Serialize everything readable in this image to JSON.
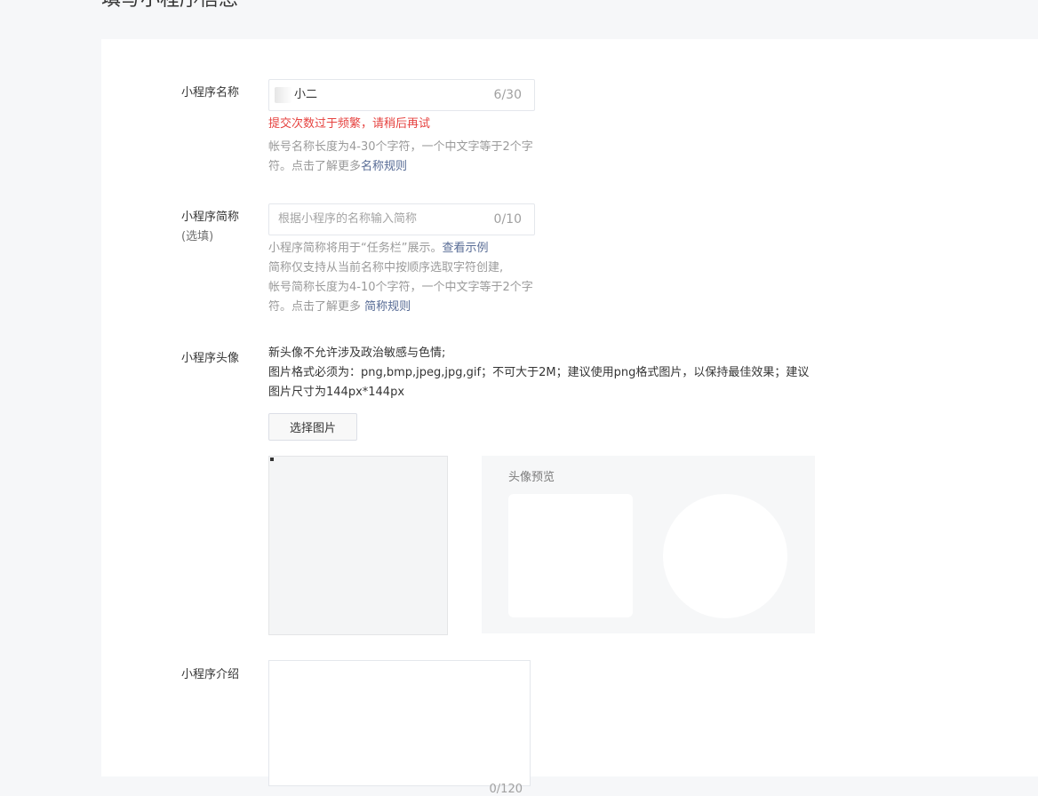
{
  "page_title": "填写小程序信息",
  "name_field": {
    "label": "小程序名称",
    "value": "小二",
    "count": "6/30",
    "error": "提交次数过于频繁，请稍后再试",
    "tip_text": "帐号名称长度为4-30个字符，一个中文字等于2个字符。点击了解更多",
    "tip_link": "名称规则"
  },
  "short_name_field": {
    "label": "小程序简称",
    "label_sub": "(选填)",
    "placeholder": "根据小程序的名称输入简称",
    "count": "0/10",
    "tip_line1_text": "小程序简称将用于“任务栏”展示。",
    "tip_line1_link": "查看示例",
    "tip_line2": "简称仅支持从当前名称中按顺序选取字符创建,",
    "tip_line3_text": "帐号简称长度为4-10个字符，一个中文字等于2个字符。点击了解更多 ",
    "tip_line3_link": "简称规则"
  },
  "avatar_field": {
    "label": "小程序头像",
    "desc_line1": "新头像不允许涉及政治敏感与色情;",
    "desc_line2": "图片格式必须为：png,bmp,jpeg,jpg,gif；不可大于2M；建议使用png格式图片，以保持最佳效果；建议图片尺寸为144px*144px",
    "choose_button": "选择图片",
    "preview_title": "头像预览"
  },
  "intro_field": {
    "label": "小程序介绍",
    "count": "0/120"
  }
}
